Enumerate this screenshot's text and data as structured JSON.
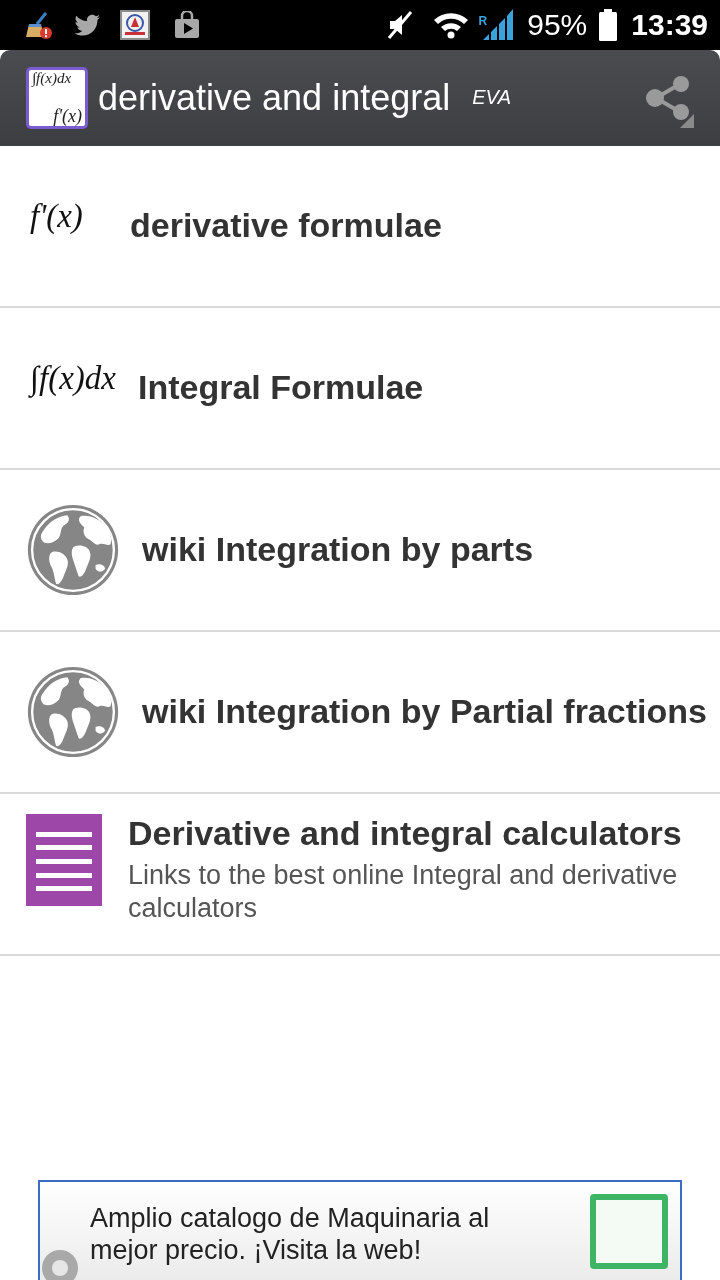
{
  "status_bar": {
    "roaming": "R",
    "battery": "95%",
    "time": "13:39"
  },
  "action_bar": {
    "logo": [
      "∫f(x)dx",
      "f'(x)"
    ],
    "title": "derivative and integral",
    "tag": "EVA"
  },
  "items": [
    {
      "kind": "formula",
      "formula": "f'(x)",
      "title": "derivative formulae"
    },
    {
      "kind": "formula",
      "formula": "∫f(x)dx",
      "title": "Integral Formulae"
    },
    {
      "kind": "globe",
      "title": "wiki Integration by parts"
    },
    {
      "kind": "globe",
      "title": "wiki Integration by Partial fractions"
    },
    {
      "kind": "document",
      "title": "Derivative and integral calculators",
      "subtitle": "Links to the best online Integral and derivative calculators"
    }
  ],
  "ad": {
    "text": "Amplio catalogo de Maquinaria al mejor precio. ¡Visita la web!"
  }
}
